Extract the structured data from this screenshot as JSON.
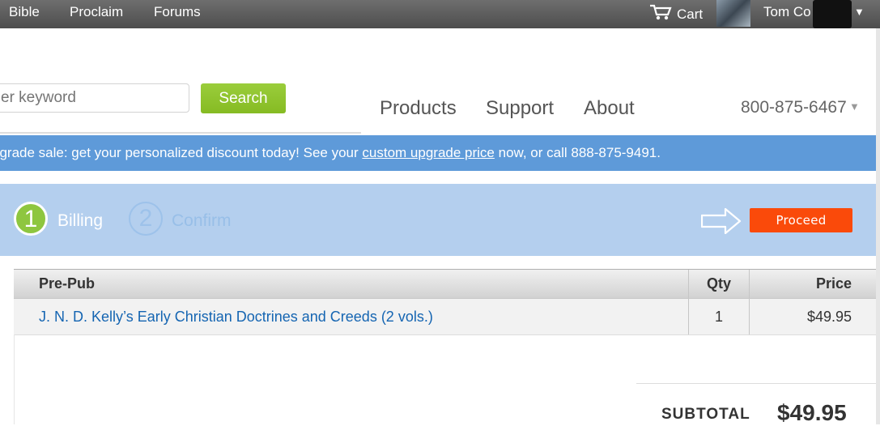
{
  "topbar": {
    "nav": [
      "Bible",
      "Proclaim",
      "Forums"
    ],
    "cart_label": "Cart",
    "user_name": "Tom Co"
  },
  "header": {
    "search_placeholder": "er keyword",
    "search_button": "Search",
    "nav": [
      "Products",
      "Support",
      "About"
    ],
    "phone": "800-875-6467"
  },
  "promo": {
    "text_before": "pgrade sale: get your personalized discount today! See your ",
    "link": "custom upgrade price",
    "text_after": " now, or call 888-875-9491."
  },
  "steps": {
    "items": [
      {
        "number": "1",
        "label": "Billing"
      },
      {
        "number": "2",
        "label": "Confirm"
      }
    ],
    "proceed": "Proceed"
  },
  "cart": {
    "headers": {
      "item": "Pre-Pub",
      "qty": "Qty",
      "price": "Price"
    },
    "rows": [
      {
        "item": "J. N. D. Kelly’s Early Christian Doctrines and Creeds (2 vols.)",
        "qty": "1",
        "price": "$49.95"
      }
    ],
    "subtotal_label": "SUBTOTAL",
    "subtotal_value": "$49.95"
  },
  "colors": {
    "accent_green": "#8ec63f",
    "promo_blue": "#5e9ad9",
    "steps_bg": "#b4cfee",
    "proceed_orange": "#fa4a0a",
    "link_blue": "#1565b2"
  }
}
